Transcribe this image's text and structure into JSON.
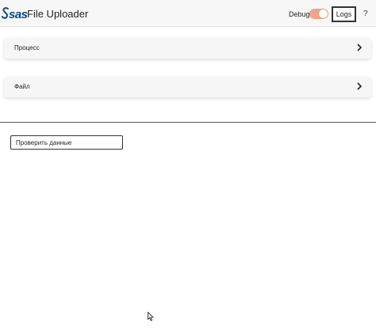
{
  "header": {
    "logo_text": "sas",
    "title": "File Uploader",
    "debug_label": "Debug",
    "debug_enabled": true,
    "logs_label": "Logs",
    "help_label": "?"
  },
  "sections": [
    {
      "label": "Процесс",
      "expanded": false
    },
    {
      "label": "Файл",
      "expanded": false
    }
  ],
  "actions": {
    "verify_label": "Проверить данные"
  },
  "colors": {
    "toggle_on": "#f0a48c",
    "logo": "#0a4a8c"
  }
}
